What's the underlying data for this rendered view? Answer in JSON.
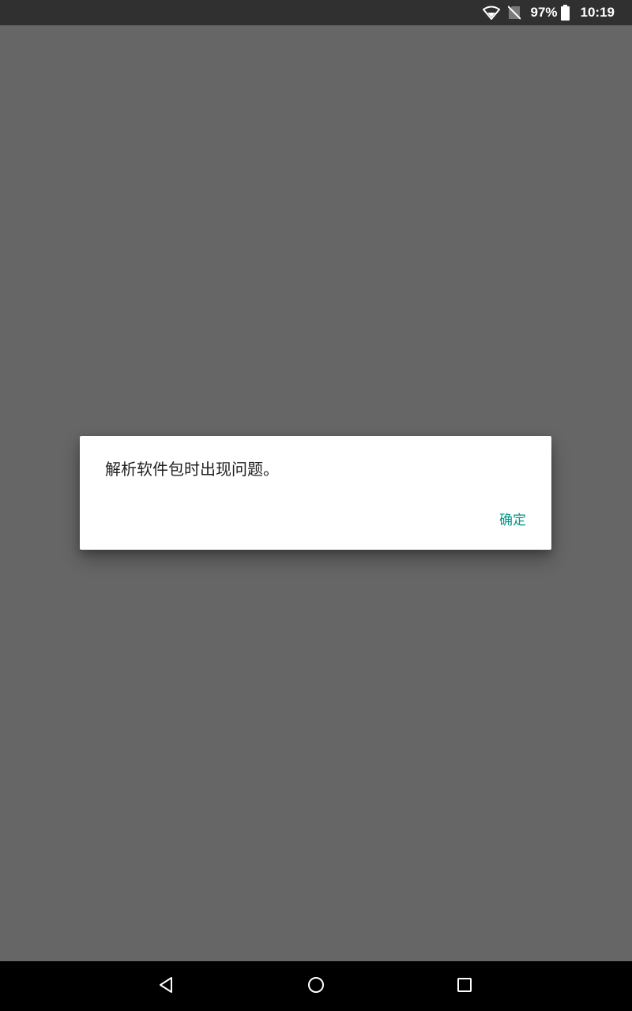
{
  "status_bar": {
    "battery_percent": "97%",
    "time": "10:19",
    "icons": [
      "wifi-icon",
      "no-sim-icon",
      "battery-icon"
    ]
  },
  "dialog": {
    "message": "解析软件包时出现问题。",
    "ok_label": "确定",
    "ok_color": "#009688"
  },
  "nav_bar": {
    "buttons": [
      "back-icon",
      "home-icon",
      "recents-icon"
    ]
  },
  "colors": {
    "scrim": "#666666",
    "status_bar_bg": "#303030",
    "nav_bar_bg": "#000000"
  }
}
